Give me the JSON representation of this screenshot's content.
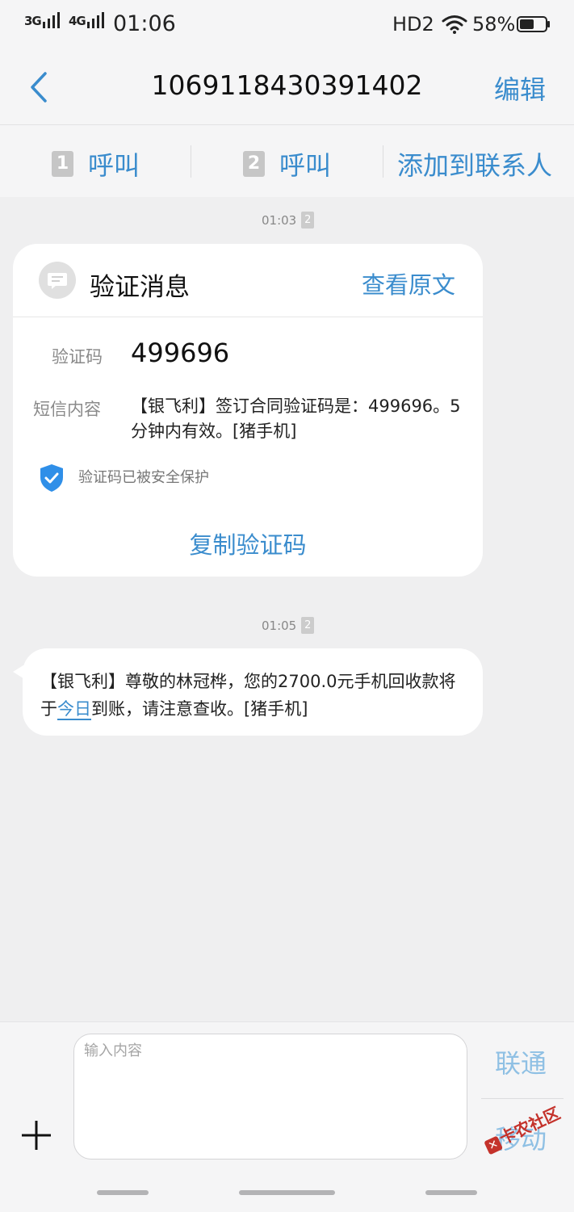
{
  "status_bar": {
    "sim1_network": "3G",
    "sim2_network": "4G",
    "time": "01:06",
    "hd_label": "HD2",
    "battery_percent": "58%",
    "battery_level": 0.58
  },
  "header": {
    "title": "1069118430391402",
    "edit_label": "编辑"
  },
  "actions": {
    "sim1_badge": "1",
    "sim1_call": "呼叫",
    "sim2_badge": "2",
    "sim2_call": "呼叫",
    "add_contact": "添加到联系人"
  },
  "messages": [
    {
      "time": "01:03",
      "sim_badge": "2",
      "card": {
        "title": "验证消息",
        "view_original": "查看原文",
        "code_label": "验证码",
        "code_value": "499696",
        "content_label": "短信内容",
        "content": "【银飞利】签订合同验证码是：499696。5分钟内有效。[猪手机]",
        "protect_text": "验证码已被安全保护",
        "copy_label": "复制验证码"
      }
    },
    {
      "time": "01:05",
      "sim_badge": "2",
      "text_before": "【银飞利】尊敬的林冠桦，您的2700.0元手机回收款将于",
      "link": "今日",
      "text_after": "到账，请注意查收。[猪手机]"
    }
  ],
  "compose": {
    "placeholder": "输入内容",
    "send_unicom": "联通",
    "send_mobile": "移动"
  },
  "watermark": "卡农社区",
  "colors": {
    "accent": "#3a8ccd",
    "send_disabled": "#8fc0e4",
    "shield": "#2f8fe8",
    "background": "#efeff0"
  }
}
